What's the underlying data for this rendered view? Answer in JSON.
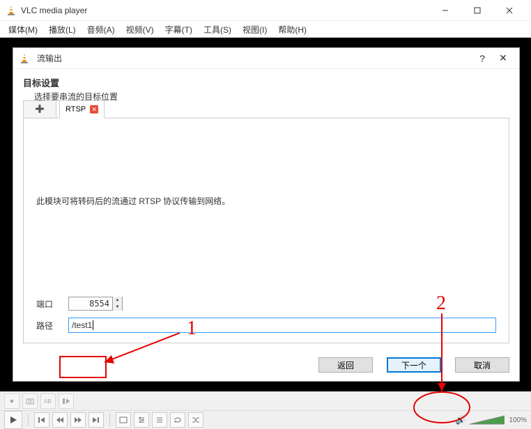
{
  "main_window": {
    "title": "VLC media player",
    "menu": {
      "media": "媒体(M)",
      "playback": "播放(L)",
      "audio": "音频(A)",
      "video": "视频(V)",
      "subtitle": "字幕(T)",
      "tools": "工具(S)",
      "view": "视图(I)",
      "help": "帮助(H)"
    }
  },
  "dialog": {
    "title": "流输出",
    "section_title": "目标设置",
    "section_sub": "选择要串流的目标位置",
    "tab_label": "RTSP",
    "description": "此模块可将转码后的流通过 RTSP 协议传输到网络。",
    "port_label": "端口",
    "port_value": "8554",
    "path_label": "路径",
    "path_value": "/test1",
    "btn_back": "返回",
    "btn_next": "下一个",
    "btn_cancel": "取消"
  },
  "status": {
    "volume_pct": "100%"
  },
  "annotations": {
    "num1": "1",
    "num2": "2"
  }
}
